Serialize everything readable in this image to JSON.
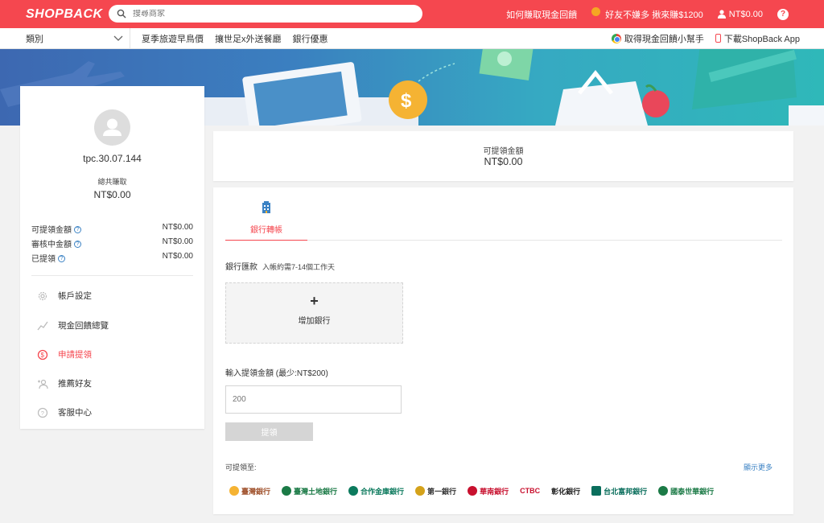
{
  "header": {
    "logo": "SHOPBACK",
    "search_placeholder": "搜尋商家",
    "how_to_earn": "如何賺取現金回饋",
    "referral": "好友不嫌多 揪來賺$1200",
    "balance": "NT$0.00"
  },
  "subnav": {
    "category": "類別",
    "links": [
      "夏季旅遊早鳥價",
      "攘世足x外送餐廳",
      "銀行優惠"
    ],
    "extension": "取得現金回饋小幫手",
    "app": "下載ShopBack App"
  },
  "profile": {
    "username": "tpc.30.07.144",
    "total_label": "總共賺取",
    "total_value": "NT$0.00",
    "stats": [
      {
        "label": "可提領金額",
        "value": "NT$0.00"
      },
      {
        "label": "審核中金額",
        "value": "NT$0.00"
      },
      {
        "label": "已提領",
        "value": "NT$0.00"
      }
    ],
    "menu": [
      {
        "label": "帳戶設定",
        "icon": "gear-icon"
      },
      {
        "label": "現金回饋總覽",
        "icon": "trend-icon"
      },
      {
        "label": "申請提領",
        "icon": "withdraw-icon"
      },
      {
        "label": "推薦好友",
        "icon": "add-user-icon"
      },
      {
        "label": "客服中心",
        "icon": "help-circle-icon"
      }
    ]
  },
  "balance": {
    "label": "可提領金額",
    "value": "NT$0.00"
  },
  "withdraw": {
    "tab_label": "銀行轉帳",
    "transfer_label": "銀行匯款",
    "transfer_note": "入帳約需7-14個工作天",
    "add_bank_plus": "+",
    "add_bank_label": "增加銀行",
    "amount_label": "輸入提領金額 (最少:NT$200)",
    "amount_placeholder": "200",
    "submit_label": "提領",
    "withdraw_to": "可提領至:",
    "show_more": "顯示更多",
    "banks": [
      "臺灣銀行",
      "臺灣土地銀行",
      "合作金庫銀行",
      "第一銀行",
      "華南銀行",
      "CTBC",
      "彰化銀行",
      "台北富邦銀行",
      "國泰世華銀行"
    ]
  },
  "colors": {
    "brand": "#f5474f",
    "link": "#3b82c4"
  }
}
